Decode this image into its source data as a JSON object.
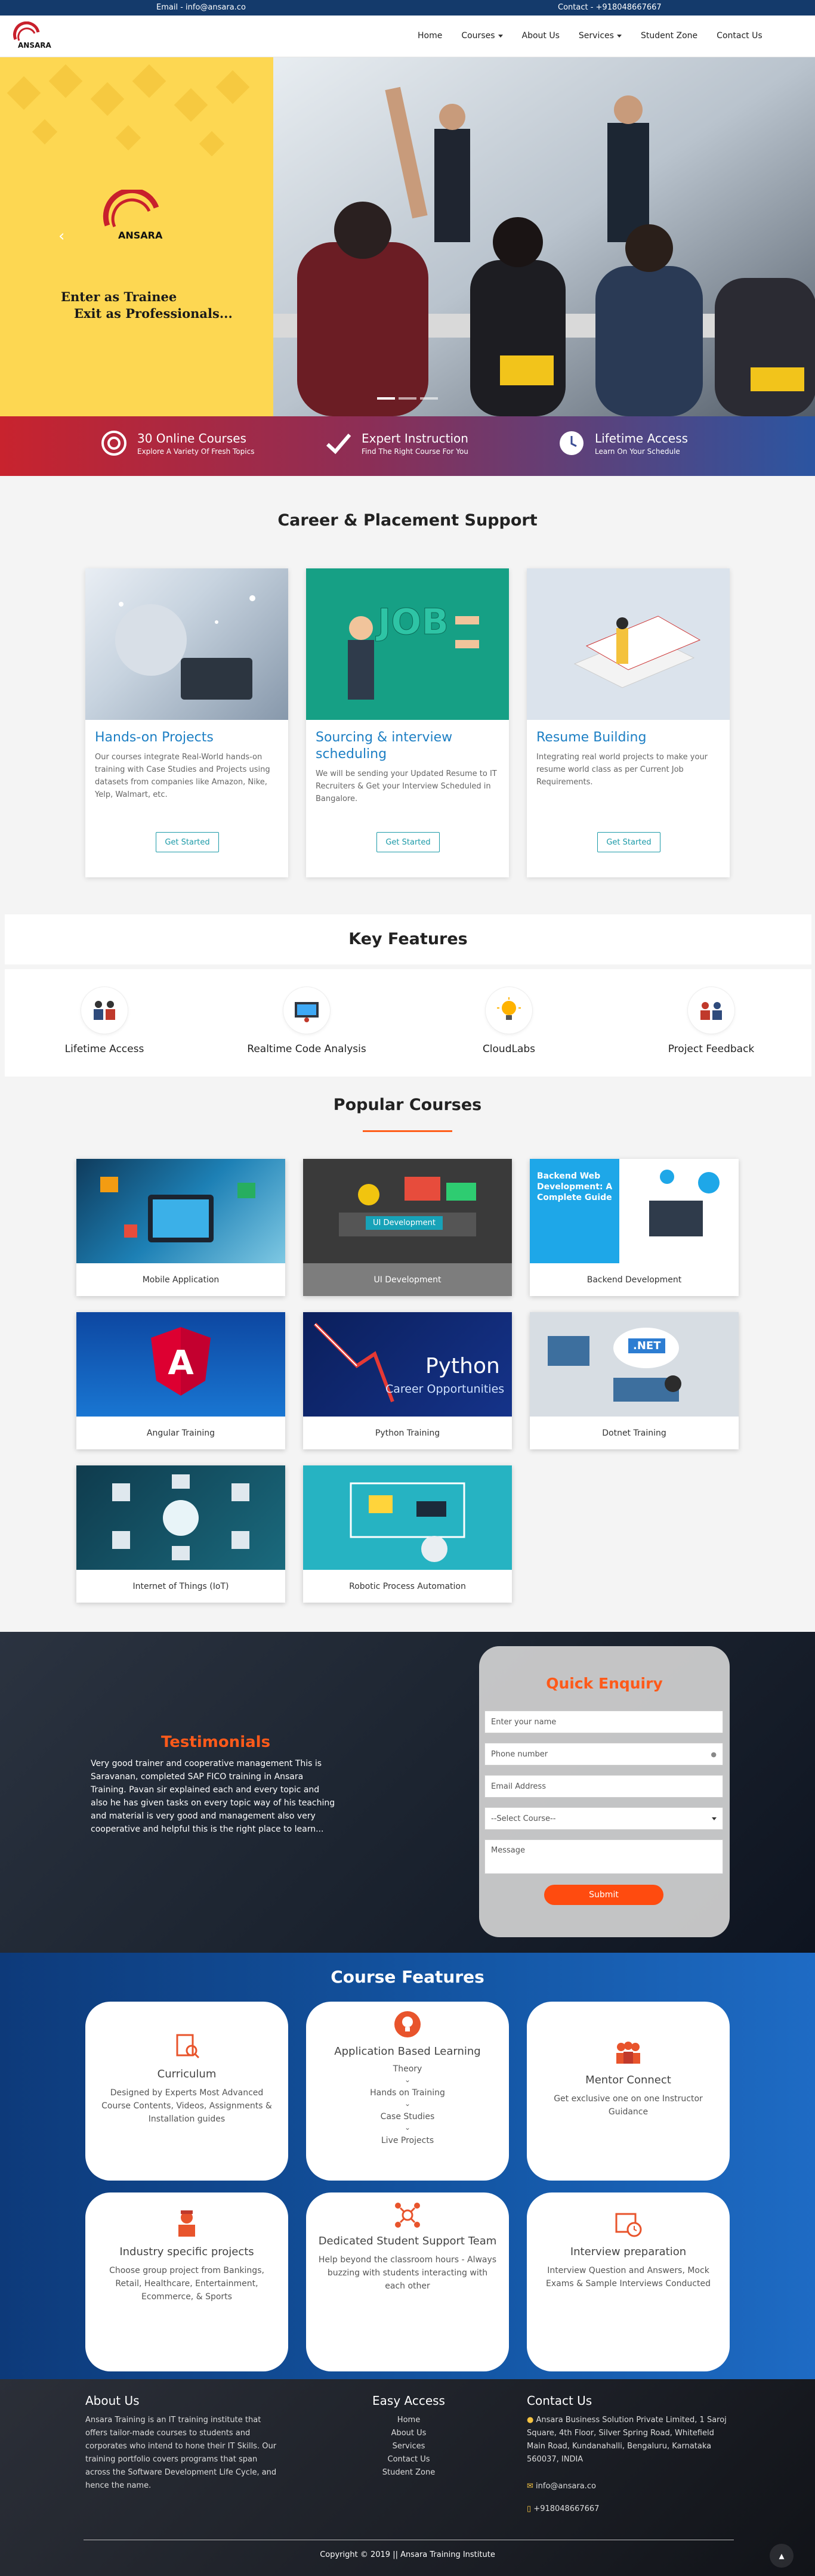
{
  "topbar": {
    "email": "Email - info@ansara.co",
    "contact": "Contact - +918048667667"
  },
  "brand": {
    "name": "ANSARA",
    "accent": "#c8202c",
    "orange": "#ff5a1a",
    "blue": "#1d7fc4"
  },
  "nav": {
    "items": [
      "Home",
      "Courses",
      "About Us",
      "Services",
      "Student Zone",
      "Contact Us"
    ]
  },
  "hero": {
    "tagline_1": "Enter as Trainee",
    "tagline_2": "Exit as Professionals...",
    "prev": "‹"
  },
  "strip": [
    {
      "title": "30 Online Courses",
      "sub": "Explore A Variety Of Fresh Topics",
      "icon": "target-icon"
    },
    {
      "title": "Expert Instruction",
      "sub": "Find The Right Course For You",
      "icon": "check-icon"
    },
    {
      "title": "Lifetime Access",
      "sub": "Learn On Your Schedule",
      "icon": "clock-icon"
    }
  ],
  "placement": {
    "title": "Career & Placement Support",
    "cards": [
      {
        "title": "Hands-on Projects",
        "text": "Our courses integrate Real-World hands-on training with Case Studies and Projects using datasets from companies like Amazon, Nike, Yelp, Walmart, etc.",
        "button": "Get Started"
      },
      {
        "title": "Sourcing & interview scheduling",
        "text": "We will be sending your Updated Resume to IT Recruiters & Get your Interview Scheduled in Bangalore.",
        "button": "Get Started"
      },
      {
        "title": "Resume Building",
        "text": "Integrating real world projects to make your resume world class as per Current Job Requirements.",
        "button": "Get Started"
      }
    ]
  },
  "key_features": {
    "title": "Key Features",
    "items": [
      "Lifetime Access",
      "Realtime Code Analysis",
      "CloudLabs",
      "Project Feedback"
    ]
  },
  "popular": {
    "title": "Popular Courses",
    "courses": [
      {
        "label": "Mobile Application"
      },
      {
        "label": "UI Development",
        "badge": "UI Development"
      },
      {
        "label": "Backend Development",
        "badge": "Backend Web Development: A Complete Guide"
      },
      {
        "label": "Angular Training"
      },
      {
        "label": "Python Training",
        "badge": "Python",
        "badge2": "Career Opportunities"
      },
      {
        "label": "Dotnet Training",
        "badge": ".NET"
      },
      {
        "label": "Internet of Things (IoT)"
      },
      {
        "label": "Robotic Process Automation"
      }
    ]
  },
  "testimonial": {
    "title": "Testimonials",
    "text": "Very good trainer and cooperative management This is Saravanan, completed SAP FICO training in Ansara Training. Pavan sir explained each and every topic and also he has given tasks on every topic way of his teaching and material is very good and management also very cooperative and helpful this is the right place to learn..."
  },
  "enquiry": {
    "title": "Quick Enquiry",
    "name": "Enter your name",
    "phone": "Phone number",
    "email": "Email Address",
    "select": "--Select Course--",
    "message": "Message",
    "submit": "Submit"
  },
  "course_features": {
    "title": "Course Features",
    "cards": [
      {
        "title": "Curriculum",
        "lines": [
          "Designed by Experts Most Advanced Course Contents, Videos, Assignments & Installation guides"
        ]
      },
      {
        "title": "Application Based Learning",
        "lines": [
          "Theory",
          "Hands on Training",
          "Case Studies",
          "Live Projects"
        ]
      },
      {
        "title": "Mentor Connect",
        "lines": [
          "Get exclusive one on one Instructor Guidance"
        ]
      },
      {
        "title": "Industry specific projects",
        "lines": [
          "Choose group project from Bankings, Retail, Healthcare, Entertainment, Ecommerce, & Sports"
        ]
      },
      {
        "title": "Dedicated Student Support Team",
        "lines": [
          "Help beyond the classroom hours - Always buzzing with students interacting with each other"
        ]
      },
      {
        "title": "Interview preparation",
        "lines": [
          "Interview Question and Answers, Mock Exams & Sample Interviews Conducted"
        ]
      }
    ]
  },
  "footer": {
    "about_title": "About Us",
    "about_text": "Ansara Training is an IT training institute that offers tailor-made courses to students and corporates who intend to hone their IT Skills. Our training portfolio covers programs that span across the Software Development Life Cycle, and hence the name.",
    "access_title": "Easy Access",
    "access_links": [
      "Home",
      "About Us",
      "Services",
      "Contact Us",
      "Student Zone"
    ],
    "contact_title": "Contact Us",
    "address": "Ansara Business Solution Private Limited, 1 Saroj Square, 4th Floor, Silver Spring Road, Whitefield Main Road, Kundanahalli, Bengaluru, Karnataka 560037, INDIA",
    "email": "info@ansara.co",
    "phone": "+918048667667",
    "copyright": "Copyright © 2019 || Ansara Training Institute"
  }
}
